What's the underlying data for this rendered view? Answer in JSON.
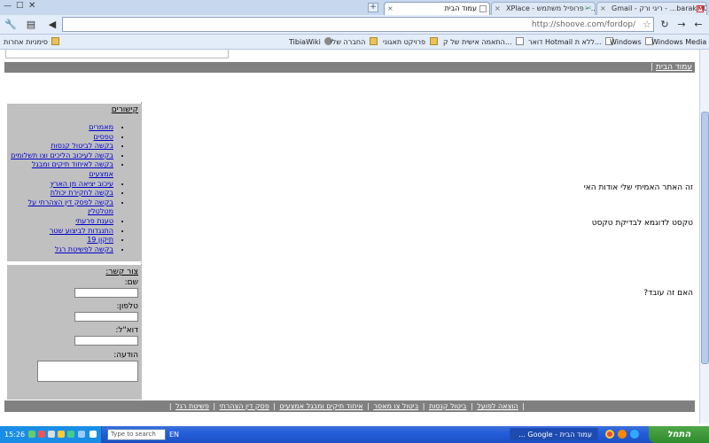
{
  "browser": {
    "tabs": [
      {
        "title": "Gmail - ריגי ורק - ...baraki30",
        "active": false
      },
      {
        "title": "XPlace - פרופיל משתמש - ...",
        "active": false
      },
      {
        "title": "עמוד הבית",
        "active": true
      }
    ],
    "new_tab_label": "+",
    "close_glyph": "×",
    "url": "http://shoove.com/fordop/",
    "star_glyph": "☆",
    "bookmarks": [
      {
        "label": "Windows Media",
        "icon": "page-icon"
      },
      {
        "label": "Windows",
        "icon": "page-icon"
      },
      {
        "label": "דואר Hotmail ללא ת...",
        "icon": "page-icon"
      },
      {
        "label": "התאמה אישית של ק...",
        "icon": "page-icon"
      },
      {
        "label": "פרויקט תאגוני",
        "icon": "folder-icon"
      },
      {
        "label": "החברה שלי",
        "icon": "folder-icon"
      },
      {
        "label": "TibiaWiki",
        "icon": "wiki-icon"
      },
      {
        "label": "סימניות אחרות",
        "icon": "folder-icon"
      }
    ]
  },
  "page": {
    "header": {
      "home_link": "עמוד הבית",
      "separator": "|"
    },
    "links": {
      "title": "קישורים",
      "items": [
        "מאמרים",
        "טפסים",
        "בקשה לביטול קנסות",
        "בקשה לעיכוב הליכים וצו תשלומים",
        "בקשה לאיחוד תיקים ומבגל אמצעים",
        "עיכוב יציאה מן הארץ",
        "בקשה לחקירת יכולת",
        "בקשה לפסק דין הצהרתי על מטלטלין",
        "טענת פרעתי",
        "התנגדות לביצוע שטר",
        "תיקון 19",
        "בקשה לפשיטת רגל"
      ]
    },
    "contact": {
      "title": "צור קשר:",
      "name_label": "שם:",
      "phone_label": "טלפון:",
      "email_label": "דוא\"ל:",
      "message_label": "הודעה:",
      "name_value": "",
      "phone_value": "",
      "email_value": "",
      "message_value": ""
    },
    "main": {
      "line1": "זה האתר האמיתי שלי אודות האי",
      "line2": "טקסט לדוגמא לבדיקת טקסט",
      "line3": "האם זה עובד?"
    },
    "footer": {
      "links": [
        "הוצאה לפועל",
        "ביטול קנסות",
        "ביטול צו מאסר",
        "איחוד תיקים ומבגל אמצעים",
        "פסק דין הצהרתי",
        "פשיטת רגל"
      ],
      "separator": "|"
    }
  },
  "taskbar": {
    "start_label": "התחל",
    "tasks": [
      {
        "label": "עמוד הבית - Google ...",
        "active": false
      }
    ],
    "search_placeholder": "Type to search",
    "language": "EN",
    "clock": "15:26"
  }
}
